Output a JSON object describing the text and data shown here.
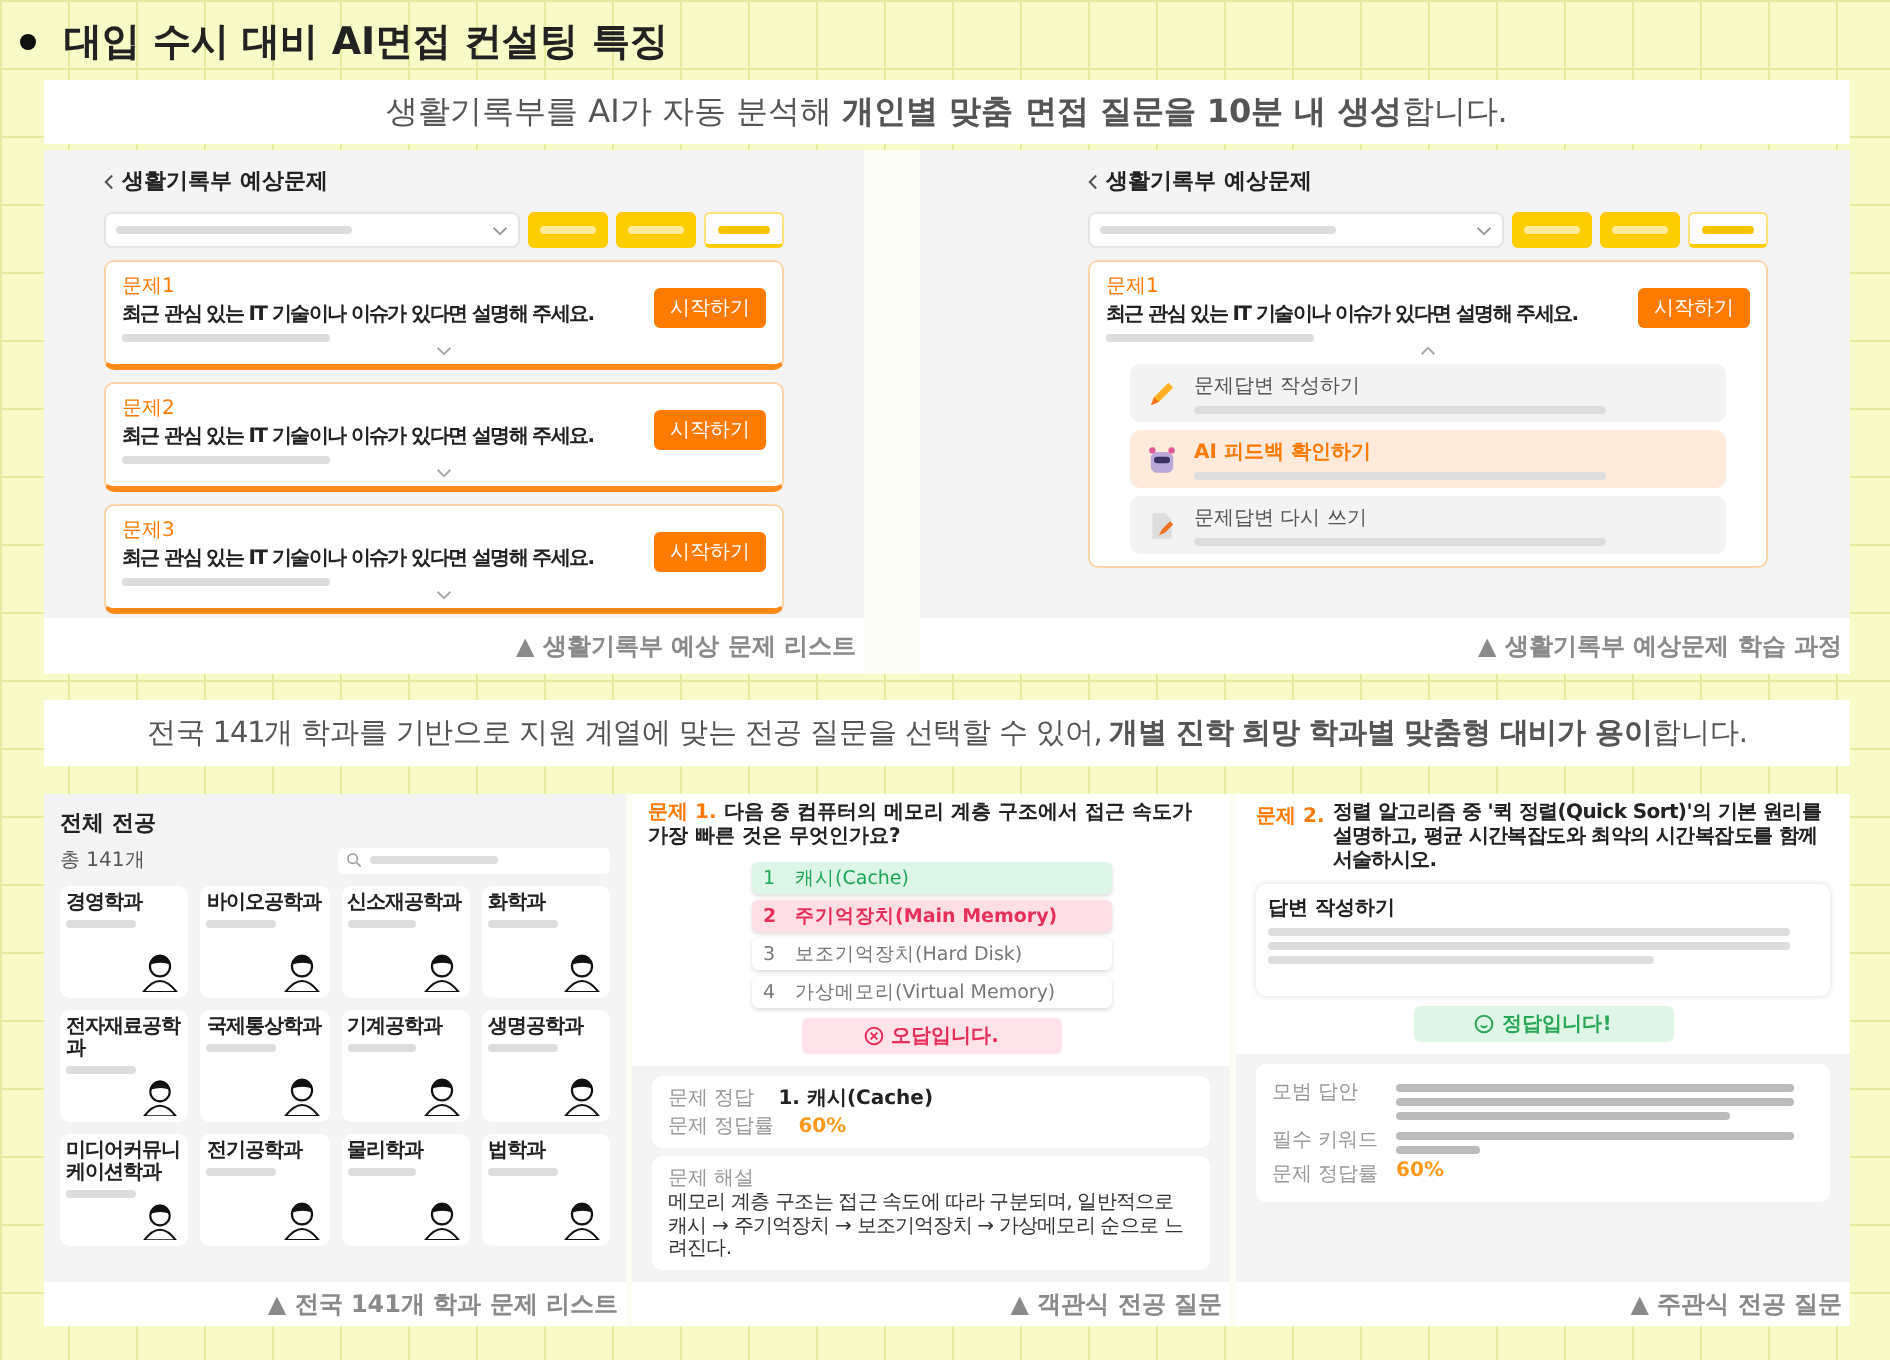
{
  "heading": "대입 수시 대비 AI면접 컨설팅 특징",
  "sections": [
    {
      "intro": "생활기록부를 AI가 자동 분석해 **개인별 맞춤 면접 질문을 10분 내 생성**합니다.",
      "screens": [
        {
          "kind": "record_questions",
          "title": "생활기록부 예상문제",
          "action_buttons": [
            {
              "outlined": false
            },
            {
              "outlined": false
            },
            {
              "outlined": true
            }
          ],
          "questions": [
            {
              "label": "문제1",
              "text": "최근 관심 있는 IT 기술이나 이슈가 있다면 설명해 주세요.",
              "button": "시작하기",
              "expanded": false
            },
            {
              "label": "문제2",
              "text": "최근 관심 있는 IT 기술이나 이슈가 있다면 설명해 주세요.",
              "button": "시작하기",
              "expanded": false
            },
            {
              "label": "문제3",
              "text": "최근 관심 있는 IT 기술이나 이슈가 있다면 설명해 주세요.",
              "button": "시작하기",
              "expanded": false
            }
          ],
          "caption": "▲ 생활기록부 예상 문제 리스트"
        },
        {
          "kind": "record_questions",
          "title": "생활기록부 예상문제",
          "action_buttons": [
            {
              "outlined": false
            },
            {
              "outlined": false
            },
            {
              "outlined": true
            }
          ],
          "questions": [
            {
              "label": "문제1",
              "text": "최근 관심 있는 IT 기술이나 이슈가 있다면 설명해 주세요.",
              "button": "시작하기",
              "expanded": true,
              "steps": [
                {
                  "kind": "write",
                  "title": "문제답변 작성하기",
                  "selected": false
                },
                {
                  "kind": "feedback",
                  "title": "AI 피드백 확인하기",
                  "selected": true
                },
                {
                  "kind": "rewrite",
                  "title": "문제답변 다시 쓰기",
                  "selected": false
                }
              ]
            }
          ],
          "caption": "▲ 생활기록부 예상문제 학습 과정"
        }
      ]
    },
    {
      "intro": "전국 141개 학과를 기반으로 지원 계열에 맞는 전공 질문을 선택할 수 있어, **개별 진학 희망 학과별 맞춤형 대비가 용이**합니다.",
      "screens": [
        {
          "kind": "major_list",
          "title": "전체 전공",
          "count": "총 141개",
          "majors": [
            "경영학과",
            "바이오공학과",
            "신소재공학과",
            "화학과",
            "전자재료공학과",
            "국제통상학과",
            "기계공학과",
            "생명공학과",
            "미디어커뮤니케이션학과",
            "전기공학과",
            "물리학과",
            "법학과"
          ],
          "caption": "▲ 전국 141개 학과 문제 리스트"
        },
        {
          "kind": "multiple_choice",
          "label": "문제 1.",
          "question": "다음 중 컴퓨터의 메모리 계층 구조에서 접근 속도가 가장 빠른 것은 무엇인가요?",
          "options": [
            {
              "number": "1",
              "text": "캐시(Cache)",
              "correct": true,
              "selected": false
            },
            {
              "number": "2",
              "text": "주기억장치(Main Memory)",
              "correct": false,
              "selected": true
            },
            {
              "number": "3",
              "text": "보조기억장치(Hard Disk)",
              "correct": false,
              "selected": false
            },
            {
              "number": "4",
              "text": "가상메모리(Virtual Memory)",
              "correct": false,
              "selected": false
            }
          ],
          "result": {
            "text": "오답입니다.",
            "correct": false
          },
          "answer_label": "문제 정답",
          "answer": "1. 캐시(Cache)",
          "rate_label": "문제 정답률",
          "rate": "60%",
          "explanation_label": "문제 해설",
          "explanation": "메모리 계층 구조는 접근 속도에 따라 구분되며, 일반적으로 캐시 → 주기억장치 → 보조기억장치 → 가상메모리 순으로 느려진다.",
          "caption": "▲ 객관식 전공 질문"
        },
        {
          "kind": "essay",
          "label": "문제 2.",
          "question": "정렬 알고리즘 중 '퀵 정렬(Quick Sort)'의 기본 원리를 설명하고, 평균 시간복잡도와 최악의 시간복잡도를 함께 서술하시오.",
          "answer_title": "답변 작성하기",
          "result": {
            "text": "정답입니다!",
            "correct": true
          },
          "details": [
            {
              "kind": "long",
              "label": "모범 답안"
            },
            {
              "kind": "short",
              "label": "필수 키워드"
            },
            {
              "kind": "rate",
              "label": "문제 정답률",
              "value": "60%"
            }
          ],
          "caption": "▲ 주관식 전공 질문"
        }
      ]
    }
  ]
}
